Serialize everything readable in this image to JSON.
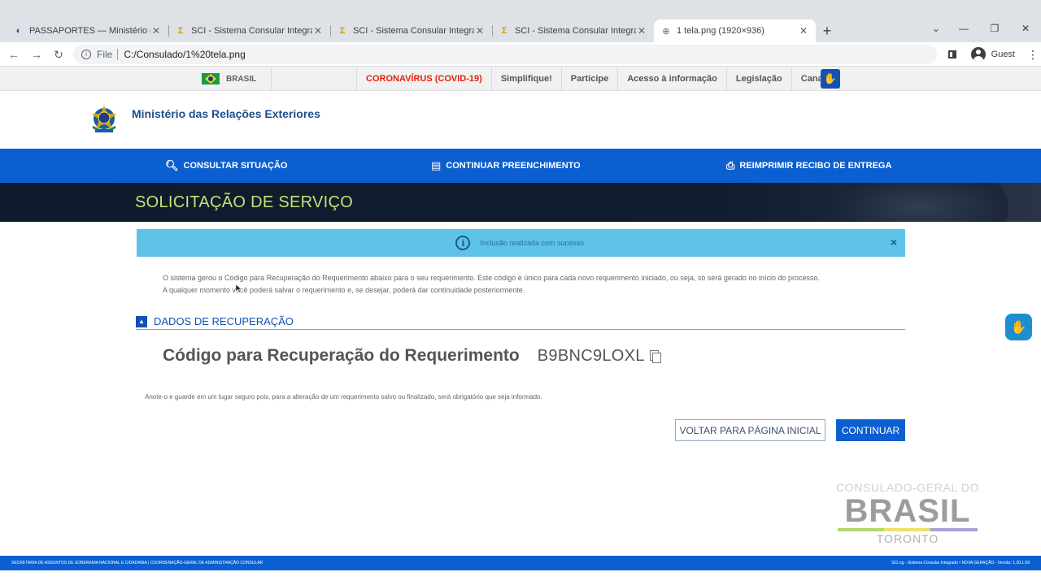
{
  "browser": {
    "tabs": [
      {
        "title": "PASSAPORTES — Ministério das",
        "favicon": "globe-icon"
      },
      {
        "title": "SCI - Sistema Consular Integrado",
        "favicon": "sci-icon"
      },
      {
        "title": "SCI - Sistema Consular Integrado",
        "favicon": "sci-icon"
      },
      {
        "title": "SCI - Sistema Consular Integrado",
        "favicon": "sci-icon"
      },
      {
        "title": "1 tela.png (1920×936)",
        "favicon": "globe-icon",
        "active": true
      }
    ],
    "address": {
      "scheme": "File",
      "url": "C:/Consulado/1%20tela.png"
    },
    "profile": "Guest"
  },
  "govbar": {
    "brasil": "BRASIL",
    "links": [
      "CORONAVÍRUS (COVID-19)",
      "Simplifique!",
      "Participe",
      "Acesso à informação",
      "Legislação",
      "Canais"
    ]
  },
  "header": {
    "title": "Ministério das Relações Exteriores"
  },
  "nav": {
    "consultar": "CONSULTAR SITUAÇÃO",
    "continuar": "CONTINUAR PREENCHIMENTO",
    "reimprimir": "REIMPRIMIR RECIBO DE ENTREGA"
  },
  "banner": {
    "title": "SOLICITAÇÃO DE SERVIÇO"
  },
  "alert": {
    "text": "Inclusão realizada com sucesso.",
    "close": "×"
  },
  "intro": {
    "line1": "O sistema gerou o Código para Recuperação do Requerimento abaixo para o seu requerimento. Este código é único para cada novo requerimento iniciado, ou seja, só será gerado no início do processo.",
    "line2": "A qualquer momento você poderá salvar o requerimento e, se desejar, poderá dar continuidade posteriormente."
  },
  "section": {
    "title": "DADOS DE RECUPERAÇÃO"
  },
  "recovery": {
    "label": "Código para Recuperação do Requerimento",
    "code": "B9BNC9LOXL"
  },
  "note": "Anote-o e guarde em um lugar seguro pois, para a alteração de um requerimento salvo ou finalizado, será obrigatório que seja informado.",
  "buttons": {
    "back": "VOLTAR PARA PÁGINA INICIAL",
    "continue": "CONTINUAR"
  },
  "watermark": {
    "top": "CONSULADO-GERAL DO",
    "big": "BRASIL",
    "bottom": "TORONTO"
  },
  "footer": {
    "left": "SECRETARIA DE ASSUNTOS DE SOBERANIA NACIONAL E CIDADANIA | COORDENAÇÃO-GERAL DE ADMINISTRAÇÃO CONSULAR",
    "right": "SCI.ng - Sistema Consular Integrado • NOVA GERAÇÃO - Versão: 1.20.1.69"
  }
}
